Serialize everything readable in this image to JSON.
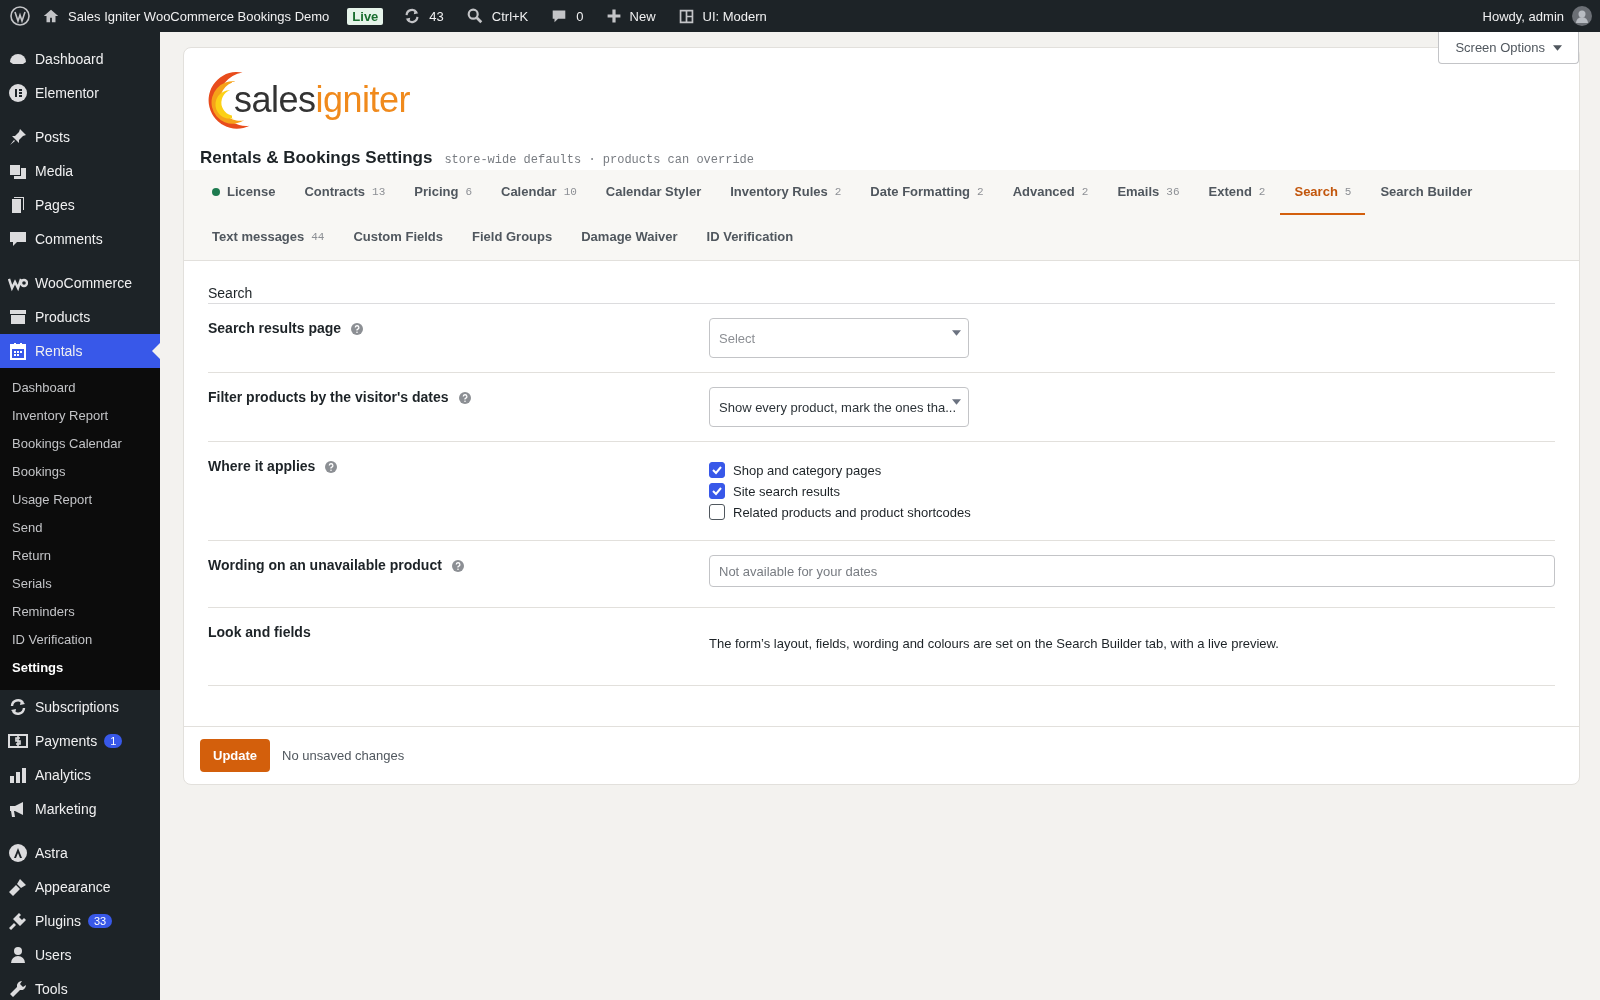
{
  "admin_bar": {
    "site_name": "Sales Igniter WooCommerce Bookings Demo",
    "live_badge": "Live",
    "updates": "43",
    "search_shortcut": "Ctrl+K",
    "comments": "0",
    "new": "New",
    "ui_mode": "UI: Modern",
    "greeting": "Howdy, admin"
  },
  "sidebar": {
    "groups": [
      [
        {
          "label": "Dashboard",
          "selected": false
        },
        {
          "label": "Elementor",
          "selected": false
        }
      ],
      [
        {
          "label": "Posts",
          "selected": false
        },
        {
          "label": "Media",
          "selected": false
        },
        {
          "label": "Pages",
          "selected": false
        },
        {
          "label": "Comments",
          "selected": false
        }
      ],
      [
        {
          "label": "WooCommerce",
          "selected": false
        },
        {
          "label": "Products",
          "selected": false
        },
        {
          "label": "Rentals",
          "selected": true,
          "children": [
            {
              "label": "Dashboard",
              "selected": false
            },
            {
              "label": "Inventory Report",
              "selected": false
            },
            {
              "label": "Bookings Calendar",
              "selected": false
            },
            {
              "label": "Bookings",
              "selected": false
            },
            {
              "label": "Usage Report",
              "selected": false
            },
            {
              "label": "Send",
              "selected": false
            },
            {
              "label": "Return",
              "selected": false
            },
            {
              "label": "Serials",
              "selected": false
            },
            {
              "label": "Reminders",
              "selected": false
            },
            {
              "label": "ID Verification",
              "selected": false
            },
            {
              "label": "Settings",
              "selected": true
            }
          ]
        },
        {
          "label": "Subscriptions",
          "selected": false
        },
        {
          "label": "Payments",
          "selected": false,
          "badge": "1"
        },
        {
          "label": "Analytics",
          "selected": false
        },
        {
          "label": "Marketing",
          "selected": false
        }
      ],
      [
        {
          "label": "Astra",
          "selected": false
        },
        {
          "label": "Appearance",
          "selected": false
        },
        {
          "label": "Plugins",
          "selected": false,
          "badge": "33"
        },
        {
          "label": "Users",
          "selected": false
        },
        {
          "label": "Tools",
          "selected": false
        }
      ]
    ]
  },
  "screen_options": "Screen Options",
  "logo": {
    "dark": "sales",
    "accent": "igniter"
  },
  "page_title": "Rentals & Bookings Settings",
  "page_subtitle": "store-wide defaults · products can override",
  "tab_rows": [
    [
      {
        "label": "License",
        "status_dot": true,
        "selected": false
      },
      {
        "label": "Contracts",
        "count": "13",
        "selected": false
      },
      {
        "label": "Pricing",
        "count": "6",
        "selected": false
      },
      {
        "label": "Calendar",
        "count": "10",
        "selected": false
      },
      {
        "label": "Calendar Styler",
        "selected": false
      },
      {
        "label": "Inventory Rules",
        "count": "2",
        "selected": false
      },
      {
        "label": "Date Formatting",
        "count": "2",
        "selected": false
      },
      {
        "label": "Advanced",
        "count": "2",
        "selected": false
      },
      {
        "label": "Emails",
        "count": "36",
        "selected": false
      },
      {
        "label": "Extend",
        "count": "2",
        "selected": false
      },
      {
        "label": "Search",
        "count": "5",
        "selected": true
      },
      {
        "label": "Search Builder",
        "selected": false
      }
    ],
    [
      {
        "label": "Text messages",
        "count": "44",
        "selected": false
      },
      {
        "label": "Custom Fields",
        "selected": false
      },
      {
        "label": "Field Groups",
        "selected": false
      },
      {
        "label": "Damage Waiver",
        "selected": false
      },
      {
        "label": "ID Verification",
        "selected": false
      }
    ]
  ],
  "section_title": "Search",
  "fields": [
    {
      "kind": "select",
      "label": "Search results page",
      "help": true,
      "placeholder": "Select"
    },
    {
      "kind": "select",
      "label": "Filter products by the visitor's dates",
      "help": true,
      "value": "Show every product, mark the ones tha..."
    },
    {
      "kind": "checkboxes",
      "label": "Where it applies",
      "help": true,
      "options": [
        {
          "label": "Shop and category pages",
          "checked": true
        },
        {
          "label": "Site search results",
          "checked": true
        },
        {
          "label": "Related products and product shortcodes",
          "checked": false
        }
      ]
    },
    {
      "kind": "text",
      "label": "Wording on an unavailable product",
      "help": true,
      "placeholder": "Not available for your dates"
    },
    {
      "kind": "note",
      "label": "Look and fields",
      "help": false,
      "text": "The form’s layout, fields, wording and colours are set on the Search Builder tab, with a live preview."
    }
  ],
  "footer": {
    "button": "Update",
    "status": "No unsaved changes"
  }
}
